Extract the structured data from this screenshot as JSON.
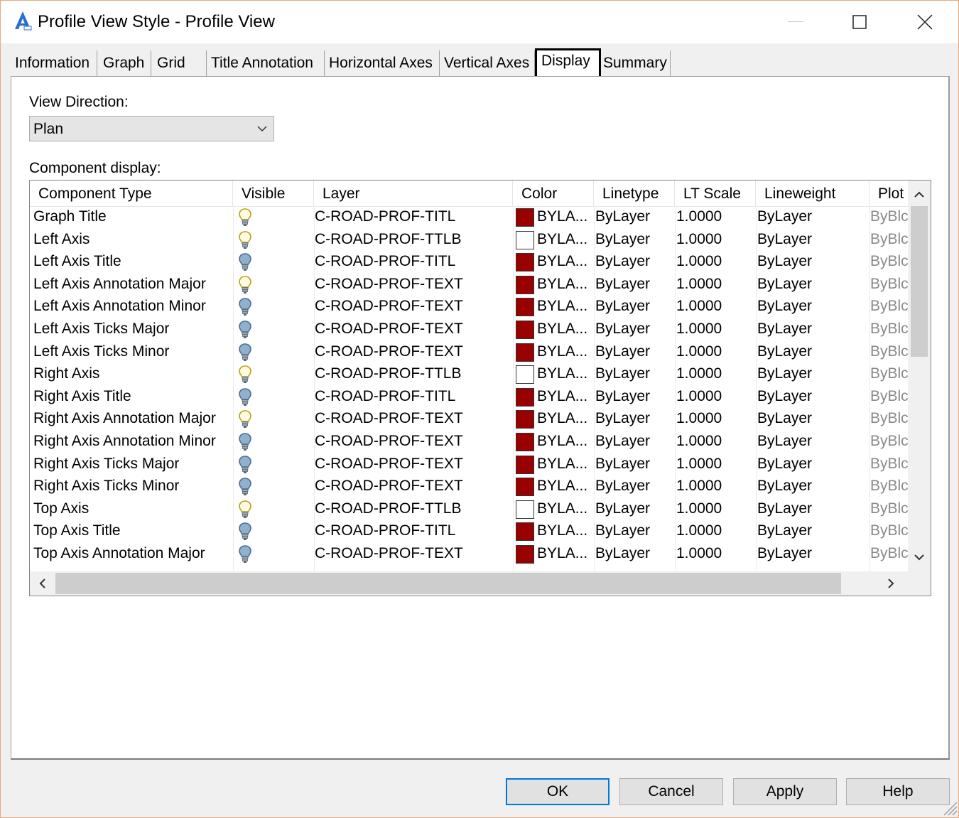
{
  "window": {
    "title": "Profile View Style - Profile View",
    "app_icon": "autocad-civil3d-icon",
    "controls": [
      "minimize-icon",
      "maximize-icon",
      "close-icon"
    ]
  },
  "tabs": [
    {
      "label": "Information"
    },
    {
      "label": "Graph"
    },
    {
      "label": "Grid"
    },
    {
      "label": "Title Annotation"
    },
    {
      "label": "Horizontal Axes"
    },
    {
      "label": "Vertical Axes"
    },
    {
      "label": "Display",
      "active": true
    },
    {
      "label": "Summary"
    }
  ],
  "view_direction": {
    "label": "View Direction:",
    "value": "Plan"
  },
  "component_display": {
    "label": "Component display:",
    "columns": [
      "Component Type",
      "Visible",
      "Layer",
      "Color",
      "Linetype",
      "LT Scale",
      "Lineweight",
      "Plot"
    ],
    "rows": [
      {
        "type": "Graph Title",
        "visible": true,
        "layer": "C-ROAD-PROF-TITL",
        "color": "BYLA...",
        "swatch": "#990000",
        "linetype": "ByLayer",
        "lt_scale": "1.0000",
        "lineweight": "ByLayer",
        "plot": "ByBlc"
      },
      {
        "type": "Left Axis",
        "visible": true,
        "layer": "C-ROAD-PROF-TTLB",
        "color": "BYLA...",
        "swatch": "#ffffff",
        "linetype": "ByLayer",
        "lt_scale": "1.0000",
        "lineweight": "ByLayer",
        "plot": "ByBlc"
      },
      {
        "type": "Left Axis Title",
        "visible": false,
        "layer": "C-ROAD-PROF-TITL",
        "color": "BYLA...",
        "swatch": "#990000",
        "linetype": "ByLayer",
        "lt_scale": "1.0000",
        "lineweight": "ByLayer",
        "plot": "ByBlc"
      },
      {
        "type": "Left Axis Annotation Major",
        "visible": true,
        "layer": "C-ROAD-PROF-TEXT",
        "color": "BYLA...",
        "swatch": "#990000",
        "linetype": "ByLayer",
        "lt_scale": "1.0000",
        "lineweight": "ByLayer",
        "plot": "ByBlc"
      },
      {
        "type": "Left Axis Annotation Minor",
        "visible": false,
        "layer": "C-ROAD-PROF-TEXT",
        "color": "BYLA...",
        "swatch": "#990000",
        "linetype": "ByLayer",
        "lt_scale": "1.0000",
        "lineweight": "ByLayer",
        "plot": "ByBlc"
      },
      {
        "type": "Left Axis Ticks Major",
        "visible": false,
        "layer": "C-ROAD-PROF-TEXT",
        "color": "BYLA...",
        "swatch": "#990000",
        "linetype": "ByLayer",
        "lt_scale": "1.0000",
        "lineweight": "ByLayer",
        "plot": "ByBlc"
      },
      {
        "type": "Left Axis Ticks Minor",
        "visible": false,
        "layer": "C-ROAD-PROF-TEXT",
        "color": "BYLA...",
        "swatch": "#990000",
        "linetype": "ByLayer",
        "lt_scale": "1.0000",
        "lineweight": "ByLayer",
        "plot": "ByBlc"
      },
      {
        "type": "Right Axis",
        "visible": true,
        "layer": "C-ROAD-PROF-TTLB",
        "color": "BYLA...",
        "swatch": "#ffffff",
        "linetype": "ByLayer",
        "lt_scale": "1.0000",
        "lineweight": "ByLayer",
        "plot": "ByBlc"
      },
      {
        "type": "Right Axis Title",
        "visible": false,
        "layer": "C-ROAD-PROF-TITL",
        "color": "BYLA...",
        "swatch": "#990000",
        "linetype": "ByLayer",
        "lt_scale": "1.0000",
        "lineweight": "ByLayer",
        "plot": "ByBlc"
      },
      {
        "type": "Right Axis Annotation Major",
        "visible": true,
        "layer": "C-ROAD-PROF-TEXT",
        "color": "BYLA...",
        "swatch": "#990000",
        "linetype": "ByLayer",
        "lt_scale": "1.0000",
        "lineweight": "ByLayer",
        "plot": "ByBlc"
      },
      {
        "type": "Right Axis Annotation Minor",
        "visible": false,
        "layer": "C-ROAD-PROF-TEXT",
        "color": "BYLA...",
        "swatch": "#990000",
        "linetype": "ByLayer",
        "lt_scale": "1.0000",
        "lineweight": "ByLayer",
        "plot": "ByBlc"
      },
      {
        "type": "Right Axis Ticks Major",
        "visible": false,
        "layer": "C-ROAD-PROF-TEXT",
        "color": "BYLA...",
        "swatch": "#990000",
        "linetype": "ByLayer",
        "lt_scale": "1.0000",
        "lineweight": "ByLayer",
        "plot": "ByBlc"
      },
      {
        "type": "Right Axis Ticks Minor",
        "visible": false,
        "layer": "C-ROAD-PROF-TEXT",
        "color": "BYLA...",
        "swatch": "#990000",
        "linetype": "ByLayer",
        "lt_scale": "1.0000",
        "lineweight": "ByLayer",
        "plot": "ByBlc"
      },
      {
        "type": "Top Axis",
        "visible": true,
        "layer": "C-ROAD-PROF-TTLB",
        "color": "BYLA...",
        "swatch": "#ffffff",
        "linetype": "ByLayer",
        "lt_scale": "1.0000",
        "lineweight": "ByLayer",
        "plot": "ByBlc"
      },
      {
        "type": "Top Axis Title",
        "visible": false,
        "layer": "C-ROAD-PROF-TITL",
        "color": "BYLA...",
        "swatch": "#990000",
        "linetype": "ByLayer",
        "lt_scale": "1.0000",
        "lineweight": "ByLayer",
        "plot": "ByBlc"
      },
      {
        "type": "Top Axis Annotation Major",
        "visible": false,
        "layer": "C-ROAD-PROF-TEXT",
        "color": "BYLA...",
        "swatch": "#990000",
        "linetype": "ByLayer",
        "lt_scale": "1.0000",
        "lineweight": "ByLayer",
        "plot": "ByBlc"
      }
    ]
  },
  "buttons": {
    "ok": "OK",
    "cancel": "Cancel",
    "apply": "Apply",
    "help": "Help"
  },
  "colors": {
    "accent": "#0078d7",
    "bulb_on": "#f5e663",
    "bulb_off": "#8fb0cf",
    "swatch_red": "#990000"
  }
}
